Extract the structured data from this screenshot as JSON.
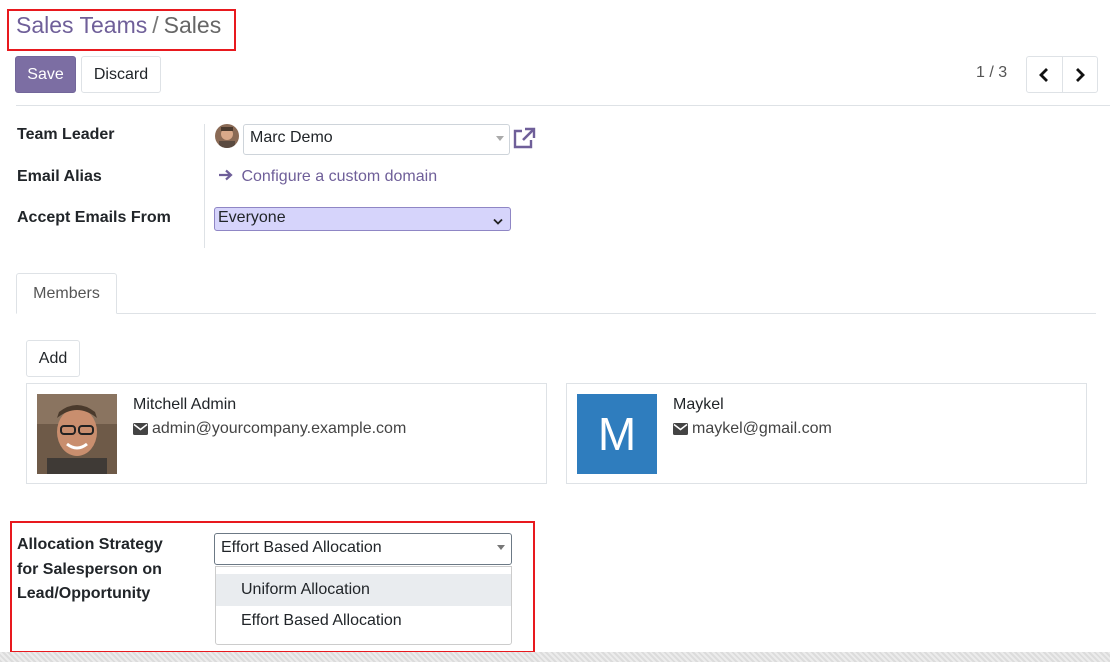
{
  "breadcrumb": {
    "parent": "Sales Teams",
    "separator": "/",
    "current": "Sales"
  },
  "toolbar": {
    "save_label": "Save",
    "discard_label": "Discard"
  },
  "pager": {
    "value": "1 / 3"
  },
  "form": {
    "team_leader": {
      "label": "Team Leader",
      "value": "Marc Demo"
    },
    "email_alias": {
      "label": "Email Alias",
      "link": "Configure a custom domain"
    },
    "accept_emails": {
      "label": "Accept Emails From",
      "value": "Everyone"
    }
  },
  "tabs": [
    {
      "label": "Members",
      "active": true
    }
  ],
  "members": {
    "add_label": "Add",
    "cards": [
      {
        "name": "Mitchell Admin",
        "email": "admin@yourcompany.example.com",
        "avatar": "photo"
      },
      {
        "name": "Maykel",
        "email": "maykel@gmail.com",
        "avatar": "M"
      }
    ]
  },
  "allocation": {
    "label": "Allocation Strategy for Salesperson on Lead/Opportunity",
    "value": "Effort Based Allocation",
    "options": [
      {
        "label": "Uniform Allocation",
        "highlighted": true
      },
      {
        "label": "Effort Based Allocation",
        "highlighted": false
      }
    ]
  },
  "colors": {
    "primary": "#7c6ea3",
    "link": "#6f5f99",
    "highlight_box": "#e8191e",
    "avatar_m": "#2f7dbe",
    "select_bg": "#d6d4fb"
  },
  "icons": [
    "chevron-left-icon",
    "chevron-right-icon",
    "external-link-icon",
    "arrow-right-icon",
    "envelope-icon",
    "chevron-down-icon",
    "caret-down-icon"
  ]
}
